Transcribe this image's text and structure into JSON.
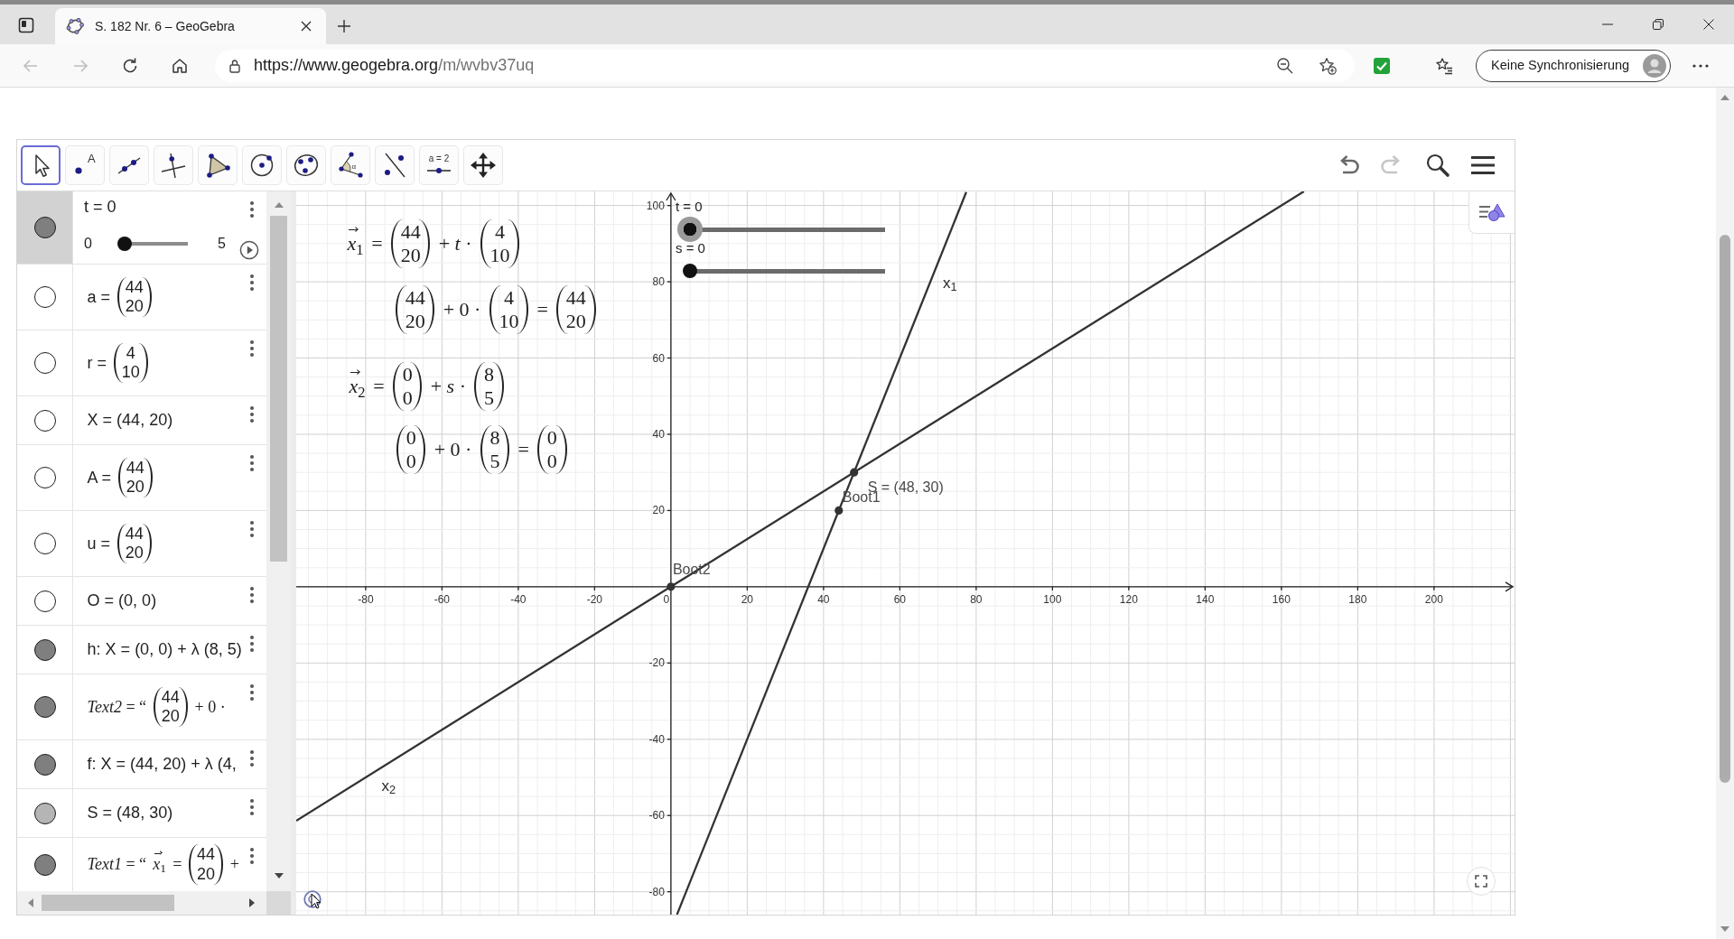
{
  "browser": {
    "tab": {
      "title": "S. 182 Nr. 6 – GeoGebra"
    },
    "back": {
      "disabled": true
    },
    "forward": {
      "disabled": true
    },
    "url": {
      "origin": "https://www.geogebra.org",
      "path": "/m/wvbv37uq"
    },
    "profile": {
      "label": "Keine Synchronisierung"
    }
  },
  "toolbar": {
    "tools": [
      {
        "kind": "move",
        "selected": true
      },
      {
        "kind": "point",
        "selected": false,
        "text": "A"
      },
      {
        "kind": "line",
        "selected": false
      },
      {
        "kind": "perpendicular",
        "selected": false
      },
      {
        "kind": "polygon",
        "selected": false
      },
      {
        "kind": "circle_center",
        "selected": false
      },
      {
        "kind": "circle_three_points",
        "selected": false
      },
      {
        "kind": "angle",
        "selected": false,
        "text": "α"
      },
      {
        "kind": "reflect",
        "selected": false
      },
      {
        "kind": "slider",
        "selected": false,
        "text": "a = 2"
      },
      {
        "kind": "move_view",
        "selected": false
      }
    ],
    "undo": {
      "disabled": false
    },
    "redo": {
      "disabled": true
    }
  },
  "algebra": {
    "rows": [
      {
        "kind": "slider",
        "selected": true,
        "visible": true,
        "color": "#7f7f7f",
        "label": "t = 0",
        "min": "0",
        "max": "5",
        "level": 0
      },
      {
        "kind": "formula",
        "selected": false,
        "visible": false,
        "parts": [
          {
            "kind": "text",
            "text": "a ="
          },
          {
            "kind": "vector",
            "entries": [
              "44",
              "20"
            ]
          }
        ]
      },
      {
        "kind": "formula",
        "selected": false,
        "visible": false,
        "parts": [
          {
            "kind": "text",
            "text": "r ="
          },
          {
            "kind": "vector",
            "entries": [
              "4",
              "10"
            ]
          }
        ]
      },
      {
        "kind": "formula",
        "selected": false,
        "visible": false,
        "parts": [
          {
            "kind": "text",
            "text": "X = (44, 20)"
          }
        ]
      },
      {
        "kind": "formula",
        "selected": false,
        "visible": false,
        "parts": [
          {
            "kind": "text",
            "text": "A ="
          },
          {
            "kind": "vector",
            "entries": [
              "44",
              "20"
            ]
          }
        ]
      },
      {
        "kind": "formula",
        "selected": false,
        "visible": false,
        "parts": [
          {
            "kind": "text",
            "text": "u ="
          },
          {
            "kind": "vector",
            "entries": [
              "44",
              "20"
            ]
          }
        ]
      },
      {
        "kind": "formula",
        "selected": false,
        "visible": false,
        "parts": [
          {
            "kind": "text",
            "text": "O = (0, 0)"
          }
        ]
      },
      {
        "kind": "formula",
        "selected": false,
        "visible": true,
        "color": "#7f7f7f",
        "parts": [
          {
            "kind": "text",
            "text": "h: X = (0, 0) + λ (8, 5)"
          }
        ]
      },
      {
        "kind": "formula",
        "selected": false,
        "visible": true,
        "color": "#7f7f7f",
        "parts": [
          {
            "kind": "math",
            "text": "*Text2* = “"
          },
          {
            "kind": "vector",
            "entries": [
              "44",
              "20"
            ]
          },
          {
            "kind": "math",
            "text": "+ 0 ·"
          }
        ]
      },
      {
        "kind": "formula",
        "selected": false,
        "visible": true,
        "color": "#7f7f7f",
        "parts": [
          {
            "kind": "text",
            "text": "f: X = (44, 20) + λ (4,"
          }
        ]
      },
      {
        "kind": "formula",
        "selected": false,
        "visible": true,
        "color": "#b5b5b5",
        "parts": [
          {
            "kind": "text",
            "text": "S = (48, 30)"
          }
        ]
      },
      {
        "kind": "formula",
        "selected": false,
        "visible": true,
        "color": "#7f7f7f",
        "parts": [
          {
            "kind": "math",
            "text": "*Text1* = “"
          },
          {
            "kind": "math",
            "text": "*x*$_{1}$",
            "arrow": true
          },
          {
            "kind": "math",
            "text": "="
          },
          {
            "kind": "vector",
            "entries": [
              "44",
              "20"
            ]
          },
          {
            "kind": "math",
            "text": "+"
          }
        ]
      }
    ]
  },
  "graphics": {
    "sliders": [
      {
        "label": "t = 0",
        "level": 0,
        "selected": true
      },
      {
        "label": "s = 0",
        "level": 0,
        "selected": false
      }
    ],
    "texts": [
      {
        "parts": [
          {
            "kind": "math",
            "text": "*x*$_{1}$",
            "arrow": true
          },
          {
            "kind": "math",
            "text": "="
          },
          {
            "kind": "vector",
            "entries": [
              "44",
              "20"
            ]
          },
          {
            "kind": "math",
            "text": "+ *t* ·"
          },
          {
            "kind": "vector",
            "entries": [
              "4",
              "10"
            ]
          }
        ]
      },
      {
        "parts": [
          {
            "kind": "vector",
            "entries": [
              "44",
              "20"
            ]
          },
          {
            "kind": "math",
            "text": "+ 0 ·"
          },
          {
            "kind": "vector",
            "entries": [
              "4",
              "10"
            ]
          },
          {
            "kind": "math",
            "text": "="
          },
          {
            "kind": "vector",
            "entries": [
              "44",
              "20"
            ]
          }
        ]
      },
      {
        "parts": [
          {
            "kind": "math",
            "text": "*x*$_{2}$",
            "arrow": true
          },
          {
            "kind": "math",
            "text": "="
          },
          {
            "kind": "vector",
            "entries": [
              "0",
              "0"
            ]
          },
          {
            "kind": "math",
            "text": "+ *s* ·"
          },
          {
            "kind": "vector",
            "entries": [
              "8",
              "5"
            ]
          }
        ]
      },
      {
        "parts": [
          {
            "kind": "vector",
            "entries": [
              "0",
              "0"
            ]
          },
          {
            "kind": "math",
            "text": "+ 0 ·"
          },
          {
            "kind": "vector",
            "entries": [
              "8",
              "5"
            ]
          },
          {
            "kind": "math",
            "text": "="
          },
          {
            "kind": "vector",
            "entries": [
              "0",
              "0"
            ]
          }
        ]
      }
    ],
    "chart_data": {
      "type": "line",
      "grid": true,
      "x": [
        -98.2,
        1.6,
        77.4,
        165.9
      ],
      "series": [
        {
          "name": "x$_{1}$",
          "color": "#333333",
          "values": [
            null,
            -86,
            103.5,
            null
          ]
        },
        {
          "name": "x$_{2}$",
          "color": "#333333",
          "values": [
            -61.4,
            1,
            48.4,
            103.7
          ]
        }
      ],
      "xlim": [
        -98.2,
        221.1
      ],
      "ylim": [
        -86,
        103.7
      ],
      "xticks": [
        -80,
        -60,
        -40,
        -20,
        0,
        20,
        40,
        60,
        80,
        100,
        120,
        140,
        160,
        180,
        200
      ],
      "yticks": [
        -80,
        -60,
        -40,
        -20,
        20,
        40,
        60,
        80,
        100
      ],
      "annotations": [
        {
          "x": 48,
          "y": 30,
          "text": "S = (48, 30)"
        },
        {
          "x": 44,
          "y": 20,
          "text": "Boot1"
        },
        {
          "x": 0,
          "y": 0,
          "text": "Boot2"
        }
      ]
    }
  }
}
